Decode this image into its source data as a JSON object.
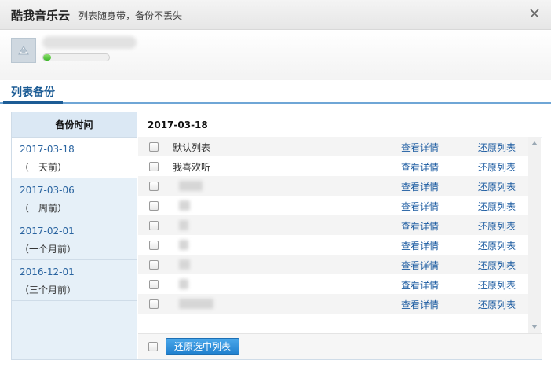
{
  "window": {
    "title": "酷我音乐云",
    "subtitle": "列表随身带，备份不丢失"
  },
  "user": {
    "progress": 0.12
  },
  "tabs": [
    {
      "label": "列表备份"
    }
  ],
  "dates": {
    "header": "备份时间",
    "items": [
      {
        "date": "2017-03-18",
        "relative": "（一天前）"
      },
      {
        "date": "2017-03-06",
        "relative": "（一周前）"
      },
      {
        "date": "2017-02-01",
        "relative": "（一个月前）"
      },
      {
        "date": "2016-12-01",
        "relative": "（三个月前）"
      }
    ]
  },
  "list": {
    "header_date": "2017-03-18",
    "detail_label": "查看详情",
    "restore_label": "还原列表",
    "rows": [
      {
        "name": "默认列表"
      },
      {
        "name": "我喜欢听"
      }
    ]
  },
  "footer": {
    "restore_selected_label": "还原选中列表"
  },
  "colors": {
    "accent": "#1c5c95",
    "link": "#1a5aa0",
    "button": "#2a8ad8",
    "sidebar_bg": "#e6f0f8"
  }
}
